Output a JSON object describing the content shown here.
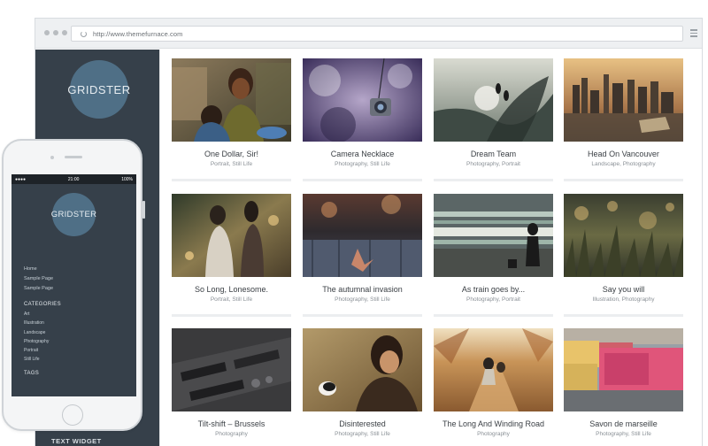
{
  "browser": {
    "url": "http://www.themefurnace.com"
  },
  "theme": {
    "logo": "GRIDSTER",
    "sidebar_widget": "TEXT WIDGET"
  },
  "portfolio": [
    {
      "title": "One Dollar, Sir!",
      "categories": "Portrait, Still Life"
    },
    {
      "title": "Camera Necklace",
      "categories": "Photography, Still Life"
    },
    {
      "title": "Dream Team",
      "categories": "Photography, Portrait"
    },
    {
      "title": "Head On Vancouver",
      "categories": "Landscape, Photography"
    },
    {
      "title": "So Long, Lonesome.",
      "categories": "Portrait, Still Life"
    },
    {
      "title": "The autumnal invasion",
      "categories": "Photography, Still Life"
    },
    {
      "title": "As train goes by...",
      "categories": "Photography, Portrait"
    },
    {
      "title": "Say you will",
      "categories": "Illustration, Photography"
    },
    {
      "title": "Tilt-shift – Brussels",
      "categories": "Photography"
    },
    {
      "title": "Disinterested",
      "categories": "Photography, Still Life"
    },
    {
      "title": "The Long And Winding Road",
      "categories": "Photography"
    },
    {
      "title": "Savon de marseille",
      "categories": "Photography, Still Life"
    }
  ],
  "phone": {
    "status_time": "21:00",
    "status_battery": "100%",
    "logo": "GRIDSTER",
    "links": [
      "Home",
      "Sample Page",
      "Sample Page"
    ],
    "categories_heading": "CATEGORIES",
    "categories": [
      "Art",
      "Illustration",
      "Landscape",
      "Photography",
      "Portrait",
      "Still Life"
    ],
    "tags_heading": "TAGS"
  }
}
